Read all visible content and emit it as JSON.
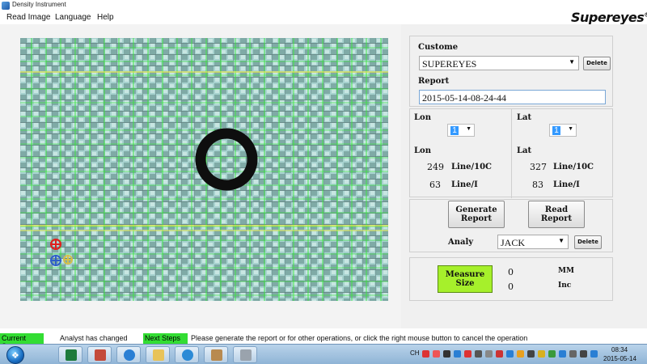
{
  "window": {
    "title": "Density Instrument"
  },
  "menu": [
    "Read Image",
    "Language",
    "Help"
  ],
  "brand": {
    "name": "Supereyes",
    "mark": "®"
  },
  "image": {
    "description_icons": [
      "red-crosshair-icon",
      "blue-crosshair-icon",
      "yellow-crosshair-icon"
    ]
  },
  "panel": {
    "customer_label": "Custome",
    "customer_value": "SUPEREYES",
    "customer_delete": "Delete",
    "report_label": "Report",
    "report_value": "2015-05-14-08-24-44",
    "lon_label": "Lon",
    "lon_select": "1",
    "lat_label": "Lat",
    "lat_select": "1",
    "lon_label2": "Lon",
    "lat_label2": "Lat",
    "lon_line10c": "249",
    "lon_linei": "63",
    "lat_line10c": "327",
    "lat_linei": "83",
    "unit_line10c": "Line/10C",
    "unit_linei": "Line/I",
    "generate_report_1": "Generate",
    "generate_report_2": "Report",
    "read_report_1": "Read",
    "read_report_2": "Report",
    "analy_label": "Analy",
    "analy_value": "JACK",
    "analy_delete": "Delete",
    "measure_1": "Measure",
    "measure_2": "Size",
    "mm_value": "0",
    "mm_unit": "MM",
    "inc_value": "0",
    "inc_unit": "Inc"
  },
  "status": {
    "current_label": "Current State",
    "current_text": "Analyst has changed",
    "next_label": "Next Steps",
    "next_text": "Please generate the report or for other operations, or click the right mouse button to cancel the operation"
  },
  "taskbar": {
    "tray_lang": "CH",
    "time": "08:34",
    "date": "2015-05-14"
  },
  "colors": {
    "accent_green": "#33dd33",
    "measure_button": "#a6f02b",
    "grid_green": "#39e83c",
    "grid_yellow": "#e6e84a",
    "ring": "#0e0e0e"
  }
}
